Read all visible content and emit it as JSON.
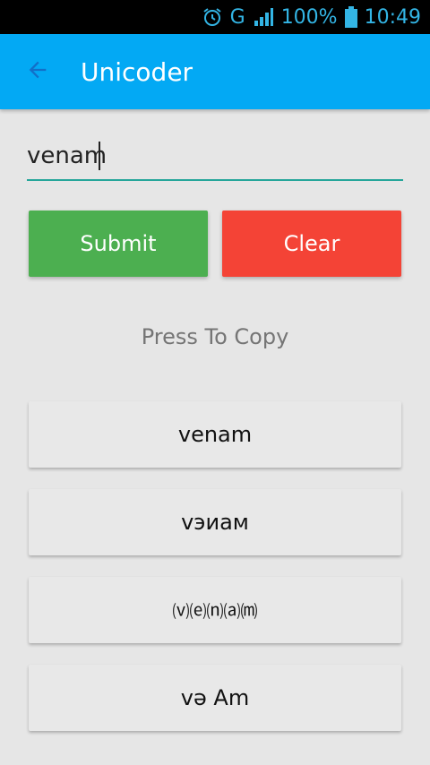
{
  "status_bar": {
    "network": "G",
    "battery": "100%",
    "time": "10:49",
    "icons": [
      "alarm-icon",
      "signal-icon",
      "battery-icon"
    ]
  },
  "app_bar": {
    "title": "Unicoder",
    "back_icon": "arrow-back-icon"
  },
  "input": {
    "value": "venam"
  },
  "buttons": {
    "submit": "Submit",
    "clear": "Clear"
  },
  "hint": "Press To Copy",
  "results": [
    "venam",
    "vэиам",
    "⒱⒠⒩⒜⒨",
    "vә Am"
  ],
  "colors": {
    "app_bar": "#03a9f4",
    "submit": "#4caf50",
    "clear": "#f44336",
    "input_underline": "#26a69a",
    "status_icons": "#33b5e5"
  }
}
